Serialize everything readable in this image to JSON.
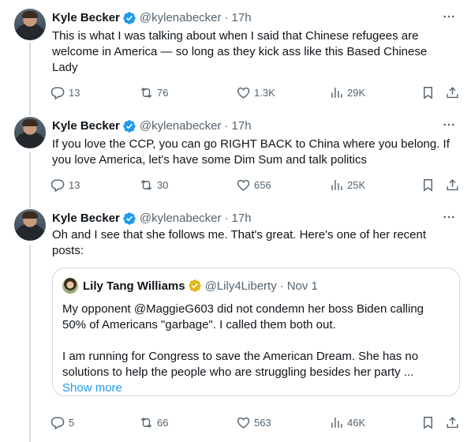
{
  "tweets": [
    {
      "name": "Kyle Becker",
      "handle": "@kylenabecker",
      "time": "17h",
      "text_lines": [
        "This is what I was talking about when I said that Chinese refugees are",
        "welcome in America — so long as they kick ass like this Based Chinese",
        "Lady"
      ],
      "replies": "13",
      "reposts": "76",
      "likes": "1.3K",
      "views": "29K"
    },
    {
      "name": "Kyle Becker",
      "handle": "@kylenabecker",
      "time": "17h",
      "text_lines": [
        "If you love the CCP, you can go RIGHT BACK to China where you belong. If",
        "you love America, let's have some Dim Sum and talk politics"
      ],
      "replies": "13",
      "reposts": "30",
      "likes": "656",
      "views": "25K"
    },
    {
      "name": "Kyle Becker",
      "handle": "@kylenabecker",
      "time": "17h",
      "text_lines": [
        "Oh and I see that she follows me. That's great. Here's one of her recent",
        "posts:"
      ],
      "quote": {
        "name": "Lily Tang Williams",
        "handle": "@Lily4Liberty",
        "time": "Nov 1",
        "para1": [
          "My opponent @MaggieG603 did not condemn her boss Biden calling",
          "50% of Americans \"garbage\". I called them both out."
        ],
        "para2": [
          "I am running for Congress to save the American Dream. She has no",
          "solutions to help the people who are struggling besides her party ..."
        ],
        "show_more": "Show more"
      },
      "replies": "5",
      "reposts": "66",
      "likes": "563",
      "views": "46K"
    }
  ],
  "separator": "·",
  "colors": {
    "verified": "#1d9bf0",
    "verified_gold": "#e2b719",
    "text": "#0f1419",
    "secondary": "#536471",
    "link": "#1d9bf0",
    "thread_line": "#cfd9de"
  },
  "icons": [
    "verified-badge-icon",
    "more-icon",
    "reply-icon",
    "repost-icon",
    "like-icon",
    "views-icon",
    "bookmark-icon",
    "share-icon"
  ]
}
